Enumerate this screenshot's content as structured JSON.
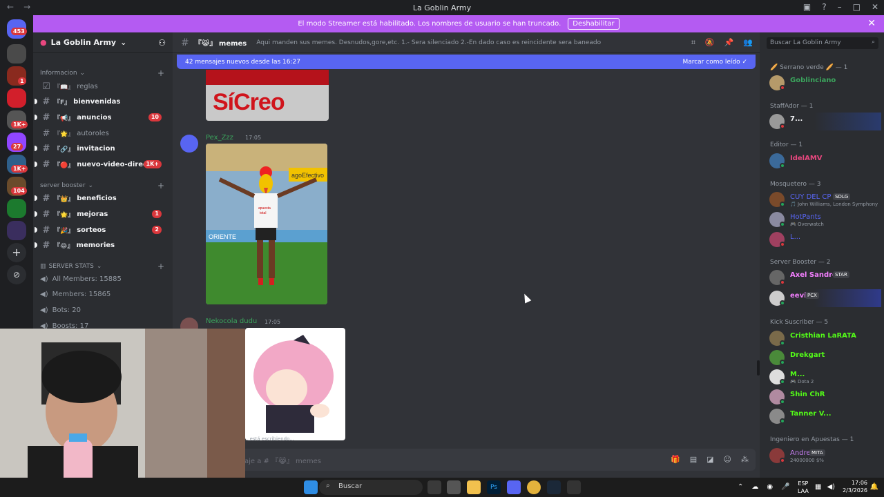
{
  "window": {
    "title": "La Goblin Army"
  },
  "banner": {
    "text": "El modo Streamer está habilitado. Los nombres de usuario se han truncado.",
    "button": "Deshabilitar"
  },
  "server": {
    "name": "La Goblin Army"
  },
  "sidebar": {
    "categories": [
      {
        "label": "Informacion"
      },
      {
        "label": "server booster"
      },
      {
        "label": "SERVER STATS"
      }
    ],
    "channels": [
      {
        "emoji": "『📖』",
        "name": "reglas",
        "badge": ""
      },
      {
        "emoji": "『F』",
        "name": "bienvenidas",
        "badge": ""
      },
      {
        "emoji": "『📢』",
        "name": "anuncios",
        "badge": "10"
      },
      {
        "emoji": "『🌟』",
        "name": "autoroles",
        "badge": ""
      },
      {
        "emoji": "『🔗』",
        "name": "invitacion",
        "badge": ""
      },
      {
        "emoji": "『🔴』",
        "name": "nuevo-video-direc...",
        "badge": "1K+"
      },
      {
        "emoji": "『👑』",
        "name": "beneficios",
        "badge": ""
      },
      {
        "emoji": "『🌟』",
        "name": "mejoras",
        "badge": "1"
      },
      {
        "emoji": "『🎉』",
        "name": "sorteos",
        "badge": "2"
      },
      {
        "emoji": "『😂』",
        "name": "memories",
        "badge": ""
      }
    ],
    "stats": [
      {
        "label": "All Members: 15885"
      },
      {
        "label": "Members: 15865"
      },
      {
        "label": "Bots: 20"
      },
      {
        "label": "Boosts: 17"
      }
    ]
  },
  "guild_badges": [
    "453",
    "1",
    "1K+",
    "27",
    "1K+",
    "104"
  ],
  "channel_header": {
    "emoji": "『😹』",
    "name": "memes",
    "topic": "Aqui manden sus memes. Desnudos,gore,etc. 1.- Sera silenciado 2.-En dado caso es reincidente sera baneado"
  },
  "new_messages": {
    "text": "42 mensajes nuevos desde las 16:27",
    "action": "Marcar como leído"
  },
  "messages": [
    {
      "image_text": "SíCreo"
    },
    {
      "author": "Pex_Zzz",
      "time": "17:05",
      "image_text_1": "apuesta",
      "image_text_2": "total",
      "image_text_3": "agoEfectivo",
      "image_text_4": "ORIENTE"
    },
    {
      "author": "Nekocola dudu",
      "time": "17:05"
    }
  ],
  "typing": {
    "text": "...está escribiendo..."
  },
  "composer": {
    "placeholder": "aje a # 『😹』 memes"
  },
  "member_search": {
    "placeholder": "Buscar La Goblin Army"
  },
  "member_groups": [
    {
      "label": "🥖 Serrano verde 🥖 — 1",
      "members": [
        {
          "name": "Goblinciano",
          "color": "#3ba55d",
          "sub": "",
          "tag": ""
        }
      ]
    },
    {
      "label": "StaffAdor — 1",
      "members": [
        {
          "name": "7...",
          "color": "#f2f3f5",
          "sub": "",
          "tag": ""
        }
      ]
    },
    {
      "label": "Editor — 1",
      "members": [
        {
          "name": "IdelAMV",
          "color": "#e9477f",
          "sub": "",
          "tag": ""
        }
      ]
    },
    {
      "label": "Mosquetero — 3",
      "members": [
        {
          "name": "CUY DEL CP",
          "color": "#5865f2",
          "sub": "🎵 John Williams, London Symphony",
          "tag": "SDLG"
        },
        {
          "name": "HotPants",
          "color": "#5865f2",
          "sub": "🎮 Overwatch",
          "tag": ""
        },
        {
          "name": "L...",
          "color": "#5865f2",
          "sub": "",
          "tag": ""
        }
      ]
    },
    {
      "label": "Server Booster — 2",
      "members": [
        {
          "name": "Axel Sandro",
          "color": "#f47fff",
          "sub": "",
          "tag": "STAR"
        },
        {
          "name": "eevi",
          "color": "#f47fff",
          "sub": "",
          "tag": "PCX"
        }
      ]
    },
    {
      "label": "Kick Suscriber — 5",
      "members": [
        {
          "name": "Cristhian LaRATA",
          "color": "#53fc18",
          "sub": "",
          "tag": ""
        },
        {
          "name": "Drekgart",
          "color": "#53fc18",
          "sub": "",
          "tag": ""
        },
        {
          "name": "M...",
          "color": "#53fc18",
          "sub": "🎮 Dota 2",
          "tag": ""
        },
        {
          "name": "Shin ChR",
          "color": "#53fc18",
          "sub": "",
          "tag": ""
        },
        {
          "name": "Tanner V...",
          "color": "#53fc18",
          "sub": "",
          "tag": ""
        }
      ]
    },
    {
      "label": "Ingeniero en Apuestas — 1",
      "members": [
        {
          "name": "Andre",
          "color": "#c27cee",
          "sub": "24000000 $%",
          "tag": "MITA"
        }
      ]
    }
  ],
  "taskbar": {
    "search": "Buscar",
    "lang_1": "ESP",
    "lang_2": "LAA",
    "time": "17:06",
    "date": "2/3/2026"
  },
  "colors": {
    "accent": "#5865f2",
    "banner": "#b45bf2",
    "danger": "#da373c",
    "kick": "#53fc18"
  }
}
